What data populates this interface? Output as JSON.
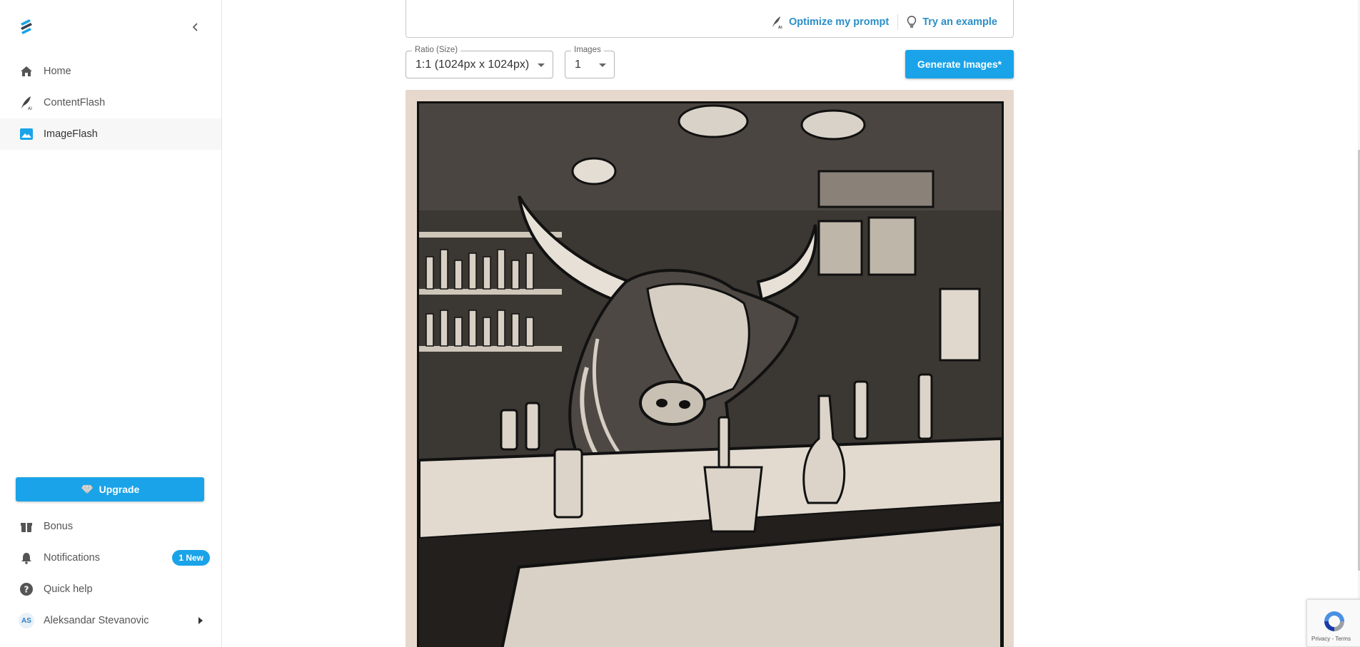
{
  "sidebar": {
    "nav": [
      {
        "label": "Home",
        "icon": "home-icon"
      },
      {
        "label": "ContentFlash",
        "icon": "quill-ai-icon"
      },
      {
        "label": "ImageFlash",
        "icon": "image-icon"
      }
    ],
    "upgrade_label": "Upgrade",
    "bottom": {
      "bonus": "Bonus",
      "notifications": "Notifications",
      "notifications_badge": "1 New",
      "quick_help": "Quick help",
      "user_initials": "AS",
      "user_name": "Aleksandar Stevanovic"
    }
  },
  "prompt": {
    "optimize_label": "Optimize my prompt",
    "example_label": "Try an example"
  },
  "controls": {
    "ratio_legend": "Ratio (Size)",
    "ratio_value": "1:1 (1024px x 1024px)",
    "images_legend": "Images",
    "images_value": "1",
    "generate_label": "Generate Images*"
  },
  "recaptcha": {
    "text": "Privacy - Terms"
  },
  "colors": {
    "accent": "#1aa3e8",
    "link": "#2b8fc7",
    "image_bg": "#e6d8cc"
  }
}
